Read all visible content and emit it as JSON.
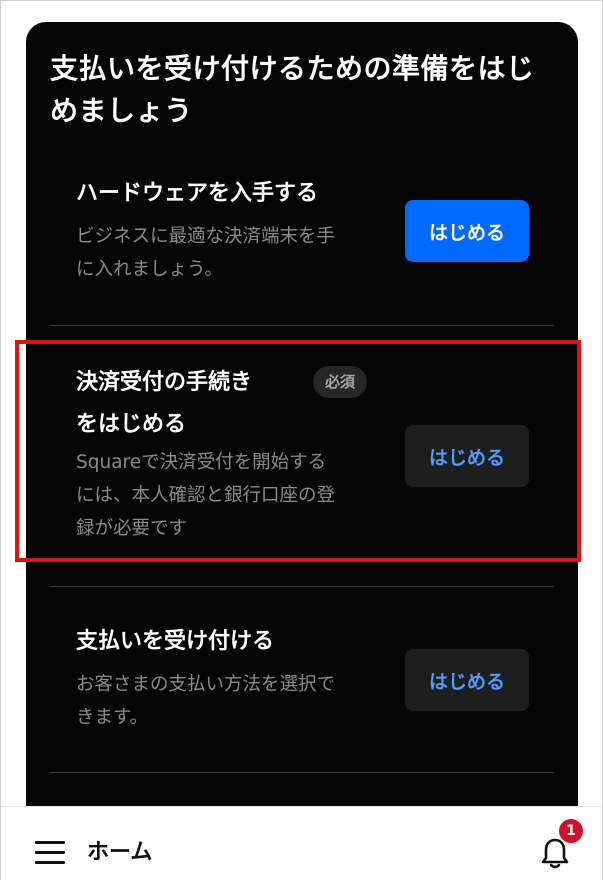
{
  "card": {
    "title_line1": "支払いを受け付けるための準備をはじ",
    "title_line2": "めましょう"
  },
  "items": [
    {
      "title_line1": "ハードウェアを入手する",
      "desc_line1": "ビジネスに最適な決済端末を手",
      "desc_line2": "に入れましょう。",
      "button_label": "はじめる"
    },
    {
      "title_line1": "決済受付の手続き",
      "title_line2": "をはじめる",
      "badge": "必須",
      "desc_line1": "Squareで決済受付を開始する",
      "desc_line2": "には、本人確認と銀行口座の登",
      "desc_line3": "録が必要です",
      "button_label": "はじめる"
    },
    {
      "title_line1": "支払いを受け付ける",
      "desc_line1": "お客さまの支払い方法を選択で",
      "desc_line2": "きます。",
      "button_label": "はじめる"
    }
  ],
  "bottom_bar": {
    "menu_icon": "hamburger-menu-icon",
    "home_label": "ホーム",
    "bell_icon": "bell-icon",
    "notification_count": "1"
  },
  "colors": {
    "card_background": "#050505",
    "primary_button": "#006aff",
    "secondary_button_text": "#4d9bff",
    "highlight_border": "#e31010",
    "notification_badge": "#d4112a"
  }
}
